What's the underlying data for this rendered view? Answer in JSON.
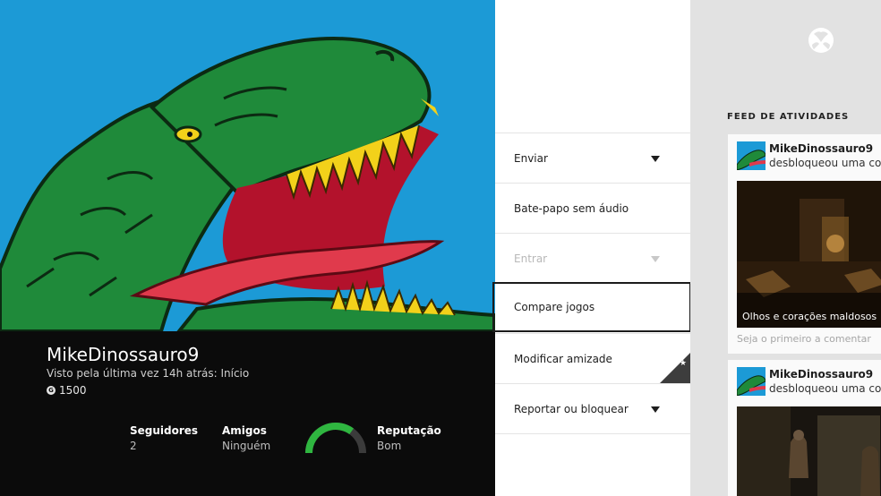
{
  "profile": {
    "gamertag": "MikeDinossauro9",
    "last_seen": "Visto pela última vez 14h atrás: Início",
    "gamerscore": "1500",
    "gamerscore_icon": "G",
    "followers_label": "Seguidores",
    "followers_value": "2",
    "friends_label": "Amigos",
    "friends_value": "Ninguém",
    "reputation_label": "Reputação",
    "reputation_value": "Bom",
    "reputation_level": 0.7,
    "banner_image": "t-rex-illustration",
    "colors": {
      "banner": "#1c9ad6",
      "dino": "#1f8a3a",
      "reputation": "#2fb640"
    }
  },
  "menu": {
    "items": [
      {
        "label": "Enviar",
        "has_dropdown": true
      },
      {
        "label": "Bate-papo sem áudio",
        "has_dropdown": false
      },
      {
        "label": "Entrar",
        "has_dropdown": true,
        "disabled": true
      },
      {
        "label": "Compare jogos",
        "has_dropdown": false,
        "selected": true
      },
      {
        "label": "Modificar amizade",
        "has_dropdown": false,
        "badge": "star-icon"
      },
      {
        "label": "Reportar ou bloquear",
        "has_dropdown": true
      }
    ]
  },
  "feed": {
    "logo": "xbox-logo-icon",
    "title": "FEED DE ATIVIDADES",
    "cards": [
      {
        "user": "MikeDinossauro9",
        "action": "desbloqueou uma conquista",
        "caption": "Olhos e corações maldosos",
        "comment_placeholder": "Seja o primeiro a comentar"
      },
      {
        "user": "MikeDinossauro9",
        "action": "desbloqueou uma conquista",
        "caption": "",
        "comment_placeholder": ""
      }
    ]
  }
}
